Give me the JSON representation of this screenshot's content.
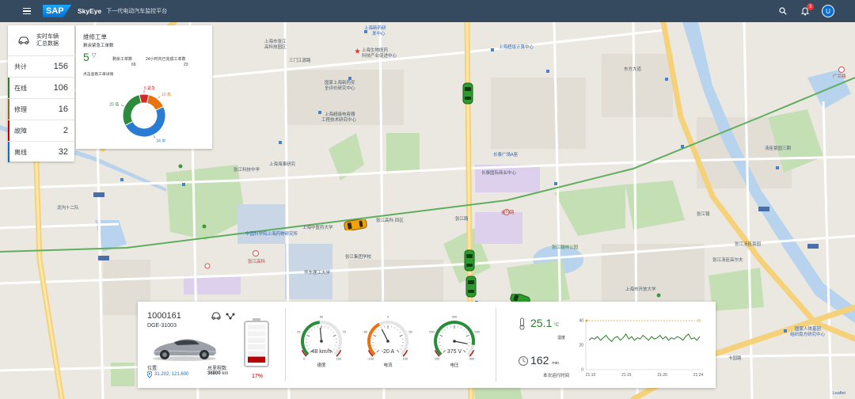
{
  "shell": {
    "logo": "SAP",
    "app_name": "SkyEye",
    "app_subtitle": "下一代电动汽车监控平台",
    "notification_count": "3",
    "avatar_initial": "U"
  },
  "summary": {
    "title_line1": "实时车辆",
    "title_line2": "汇总数据",
    "rows": [
      {
        "label": "共计",
        "value": "156"
      },
      {
        "label": "在线",
        "value": "106"
      },
      {
        "label": "修理",
        "value": "16"
      },
      {
        "label": "故障",
        "value": "2"
      },
      {
        "label": "离线",
        "value": "32"
      }
    ]
  },
  "work_orders": {
    "title": "维修工单",
    "subtitle": "剩余紧急工单数",
    "urgent_count": "5",
    "stat1_label": "剩余工单数",
    "stat1_value": "69",
    "stat2_label": "24小时内已完成工单数",
    "stat2_value": "23",
    "link": "点击查看工单详情",
    "donut": [
      {
        "name": "紧急",
        "value": 5,
        "label": "5 紧急",
        "color": "#d22a2a"
      },
      {
        "name": "高",
        "value": 10,
        "label": "10 高",
        "color": "#e9730c"
      },
      {
        "name": "中",
        "value": 34,
        "label": "34 中",
        "color": "#2a7bd3"
      },
      {
        "name": "低",
        "value": 20,
        "label": "20 低",
        "color": "#2b8c3d"
      }
    ]
  },
  "vehicle": {
    "id": "1000161",
    "plate": "DGE-31003",
    "position_label": "位置:",
    "position_value": "31.202, 121.600",
    "mileage_label": "总里程数:",
    "mileage_value": "36800",
    "mileage_unit": "km",
    "battery_pct": "17%",
    "battery_level": 0.17,
    "gauges": [
      {
        "name": "速度",
        "value": 48,
        "display": "48 km/h",
        "min": 0,
        "max": 100,
        "ticks": [
          "0",
          "25",
          "50",
          "75",
          "100"
        ],
        "color": "#2b8c3d"
      },
      {
        "name": "电流",
        "value": -20,
        "display": "-20 A",
        "min": -100,
        "max": 100,
        "ticks": [
          "-100",
          "-50",
          "0",
          "50",
          "100"
        ],
        "color": "#e9730c"
      },
      {
        "name": "电压",
        "value": 375,
        "display": "375 V",
        "min": 200,
        "max": 400,
        "ticks": [
          "200",
          "250",
          "300",
          "350",
          "400"
        ],
        "color": "#2b8c3d"
      }
    ],
    "temperature": "25.1",
    "temperature_unit": "°C",
    "humidity_label": "湿度",
    "run_time": "162",
    "run_unit": "min",
    "run_label": "本次运行时间"
  },
  "chart_data": {
    "type": "line",
    "title": "",
    "xlabel": "",
    "ylabel": "",
    "x": [
      "21:10",
      "21:15",
      "21:20",
      "21:24"
    ],
    "ylim": [
      0,
      40
    ],
    "yticks": [
      "0",
      "20",
      "40"
    ],
    "reference_line": {
      "value": 40,
      "label": "40"
    },
    "series": [
      {
        "values": [
          24,
          26,
          25,
          27,
          24,
          26,
          28,
          25,
          23,
          26,
          27,
          24,
          26,
          29,
          25,
          27,
          24,
          26,
          25,
          28,
          26,
          24,
          27,
          25,
          26,
          28,
          25,
          27,
          24,
          26,
          25,
          27,
          26,
          24,
          27,
          29,
          25,
          26,
          24,
          27
        ],
        "color": "#2b7c2b"
      }
    ]
  },
  "map": {
    "labels": [
      {
        "t": "上海市张江",
        "c": ""
      },
      {
        "t": "高科技园区",
        "c": ""
      },
      {
        "t": "上海新药研",
        "c": "blue"
      },
      {
        "t": "发中心",
        "c": "blue"
      },
      {
        "t": "上海生物医药",
        "c": ""
      },
      {
        "t": "科技产业促进中心",
        "c": ""
      },
      {
        "t": "三门江源路",
        "c": ""
      },
      {
        "t": "上海超级计算中心",
        "c": "blue"
      },
      {
        "t": "国家上海新药安",
        "c": ""
      },
      {
        "t": "全评价研究中心",
        "c": ""
      },
      {
        "t": "上海超级电容器",
        "c": ""
      },
      {
        "t": "工程技术研究中心",
        "c": ""
      },
      {
        "t": "长泰广场A座",
        "c": "blue"
      },
      {
        "t": "长泰国际商业中心",
        "c": ""
      },
      {
        "t": "张江高科·四区",
        "c": ""
      },
      {
        "t": "张江高科",
        "c": "red"
      },
      {
        "t": "金科路",
        "c": "red"
      },
      {
        "t": "上海中医药大学",
        "c": ""
      },
      {
        "t": "张江路",
        "c": ""
      },
      {
        "t": "中国科学院上海药物研究所",
        "c": "blue"
      },
      {
        "t": "华东理工大学",
        "c": ""
      },
      {
        "t": "张江翰林公园",
        "c": "green"
      },
      {
        "t": "广兰路",
        "c": "red"
      },
      {
        "t": "国家人体基因",
        "c": "blue"
      },
      {
        "t": "组织南方研究中心",
        "c": "blue"
      },
      {
        "t": "张江汤臣豪园",
        "c": ""
      },
      {
        "t": "上海市开放大学",
        "c": ""
      },
      {
        "t": "张江汤臣高尔夫",
        "c": ""
      },
      {
        "t": "汤臣豪园三期",
        "c": ""
      },
      {
        "t": "张江镇",
        "c": ""
      },
      {
        "t": "龙沟十二队",
        "c": ""
      },
      {
        "t": "张江科技中学",
        "c": ""
      },
      {
        "t": "上海海事研究",
        "c": ""
      },
      {
        "t": "张江集团学校",
        "c": ""
      },
      {
        "t": "东方大道",
        "c": ""
      },
      {
        "t": "卡园路",
        "c": ""
      }
    ],
    "attribution": "Leaflet"
  }
}
